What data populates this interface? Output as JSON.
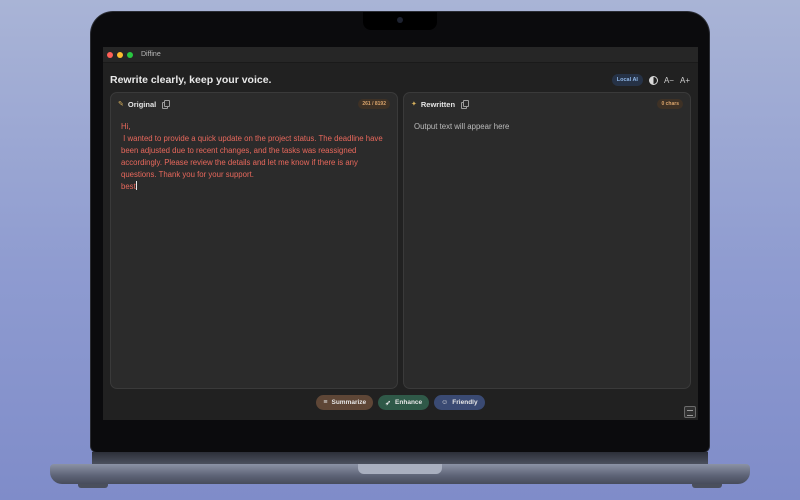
{
  "window": {
    "title": "Diffine"
  },
  "header": {
    "headline": "Rewrite clearly, keep your voice.",
    "local_ai_label": "Local AI",
    "font_decrease_label": "A−",
    "font_increase_label": "A+"
  },
  "original": {
    "title": "Original",
    "counter": "261 / 8192",
    "text": "Hi,\n I wanted to provide a quick update on the project status. The deadline have been adjusted due to recent changes, and the tasks was reassigned accordingly. Please review the details and let me know if there is any questions. Thank you for your support.\nbest"
  },
  "rewritten": {
    "title": "Rewritten",
    "counter": "0 chars",
    "placeholder": "Output text will appear here"
  },
  "actions": {
    "summarize_label": "Summarize",
    "enhance_label": "Enhance",
    "friendly_label": "Friendly"
  },
  "colors": {
    "accent_text": "#e8685c",
    "summarize": "#5e4636",
    "enhance": "#2f5948",
    "friendly": "#3a4a73"
  }
}
